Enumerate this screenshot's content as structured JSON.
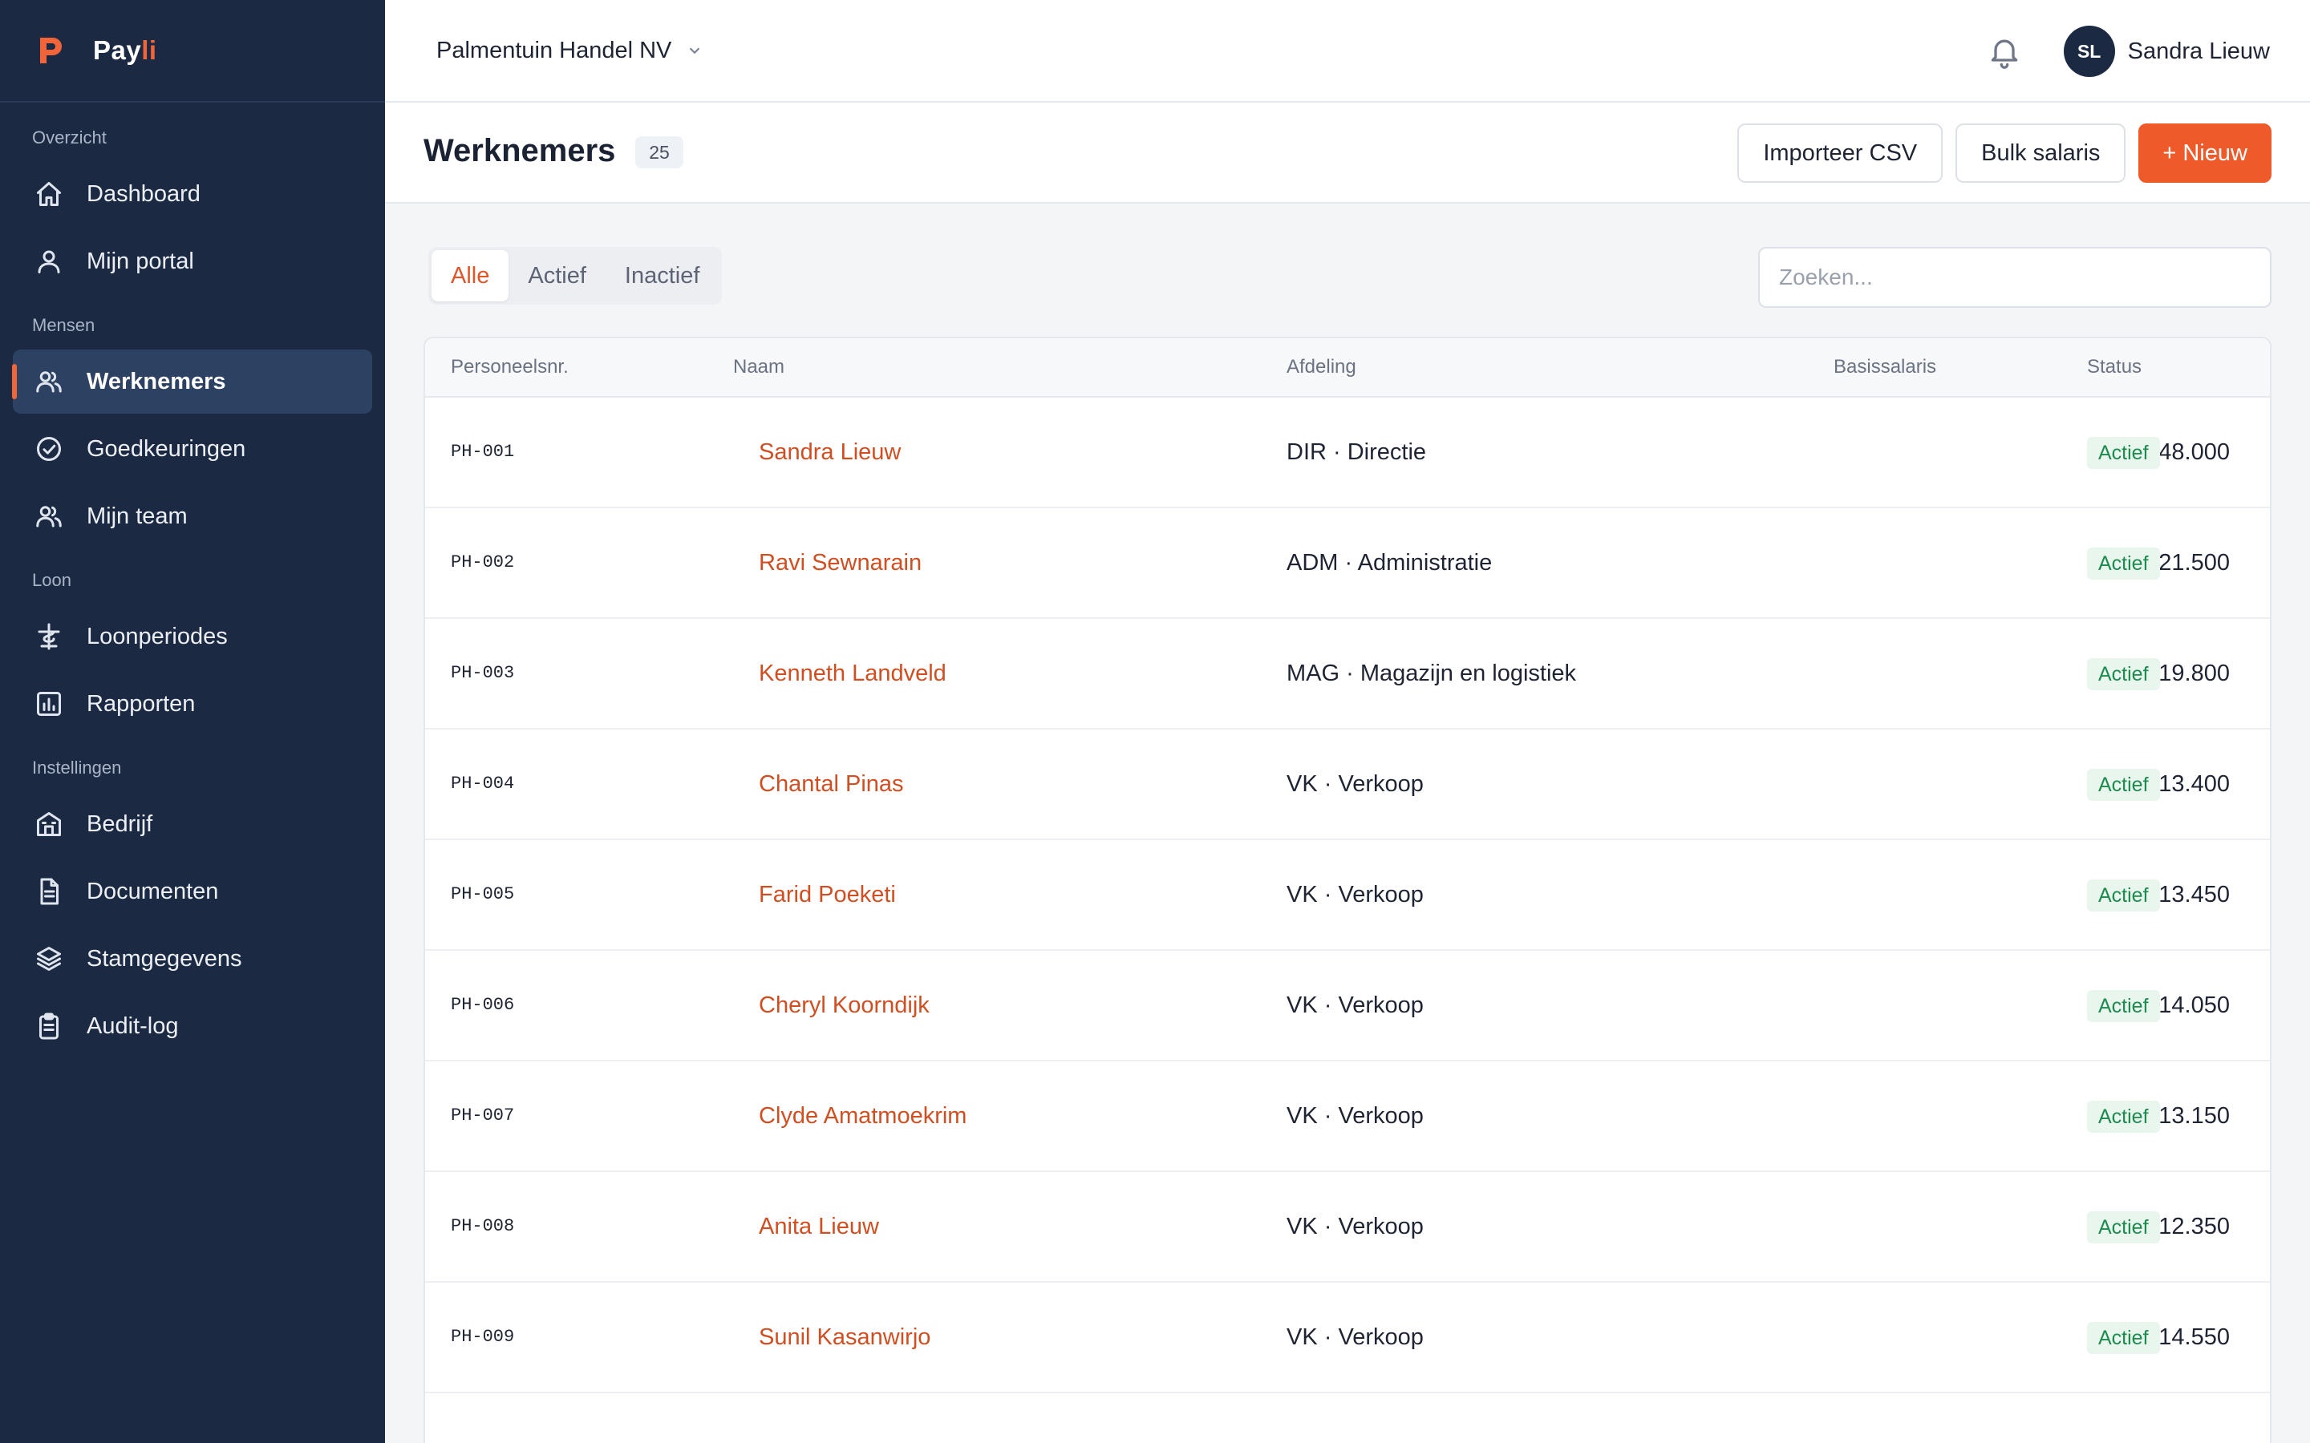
{
  "brand": {
    "name_main": "Pay",
    "name_accent": "li",
    "accent_color": "#f2643a"
  },
  "sidebar": {
    "sections": [
      {
        "label": "Overzicht",
        "items": [
          {
            "label": "Dashboard",
            "icon": "home-icon"
          },
          {
            "label": "Mijn portal",
            "icon": "user-icon"
          }
        ]
      },
      {
        "label": "Mensen",
        "items": [
          {
            "label": "Werknemers",
            "icon": "users-icon",
            "active": true
          },
          {
            "label": "Goedkeuringen",
            "icon": "check-circle-icon"
          },
          {
            "label": "Mijn team",
            "icon": "users-icon"
          }
        ]
      },
      {
        "label": "Loon",
        "items": [
          {
            "label": "Loonperiodes",
            "icon": "currency-icon"
          },
          {
            "label": "Rapporten",
            "icon": "bar-chart-icon"
          }
        ]
      },
      {
        "label": "Instellingen",
        "items": [
          {
            "label": "Bedrijf",
            "icon": "building-icon"
          },
          {
            "label": "Documenten",
            "icon": "document-icon"
          },
          {
            "label": "Stamgegevens",
            "icon": "layers-icon"
          },
          {
            "label": "Audit-log",
            "icon": "clipboard-icon"
          }
        ]
      }
    ]
  },
  "topbar": {
    "company": "Palmentuin Handel NV",
    "user_initials": "SL",
    "user_name": "Sandra Lieuw"
  },
  "page": {
    "title": "Werknemers",
    "count": "25",
    "import_label": "Importeer CSV",
    "bulk_label": "Bulk salaris",
    "new_label": "+ Nieuw"
  },
  "filters": {
    "tabs": [
      "Alle",
      "Actief",
      "Inactief"
    ],
    "active_tab": "Alle",
    "search_placeholder": "Zoeken..."
  },
  "table": {
    "headers": {
      "id": "Personeelsnr.",
      "name": "Naam",
      "dept": "Afdeling",
      "salary": "Basissalaris",
      "status": "Status"
    },
    "rows": [
      {
        "id": "PH-001",
        "name": "Sandra Lieuw",
        "dept": "DIR · Directie",
        "salary": "48.000",
        "status": "Actief"
      },
      {
        "id": "PH-002",
        "name": "Ravi Sewnarain",
        "dept": "ADM · Administratie",
        "salary": "21.500",
        "status": "Actief"
      },
      {
        "id": "PH-003",
        "name": "Kenneth Landveld",
        "dept": "MAG · Magazijn en logistiek",
        "salary": "19.800",
        "status": "Actief"
      },
      {
        "id": "PH-004",
        "name": "Chantal Pinas",
        "dept": "VK · Verkoop",
        "salary": "13.400",
        "status": "Actief"
      },
      {
        "id": "PH-005",
        "name": "Farid Poeketi",
        "dept": "VK · Verkoop",
        "salary": "13.450",
        "status": "Actief"
      },
      {
        "id": "PH-006",
        "name": "Cheryl Koorndijk",
        "dept": "VK · Verkoop",
        "salary": "14.050",
        "status": "Actief"
      },
      {
        "id": "PH-007",
        "name": "Clyde Amatmoekrim",
        "dept": "VK · Verkoop",
        "salary": "13.150",
        "status": "Actief"
      },
      {
        "id": "PH-008",
        "name": "Anita Lieuw",
        "dept": "VK · Verkoop",
        "salary": "12.350",
        "status": "Actief"
      },
      {
        "id": "PH-009",
        "name": "Sunil Kasanwirjo",
        "dept": "VK · Verkoop",
        "salary": "14.550",
        "status": "Actief"
      }
    ]
  }
}
